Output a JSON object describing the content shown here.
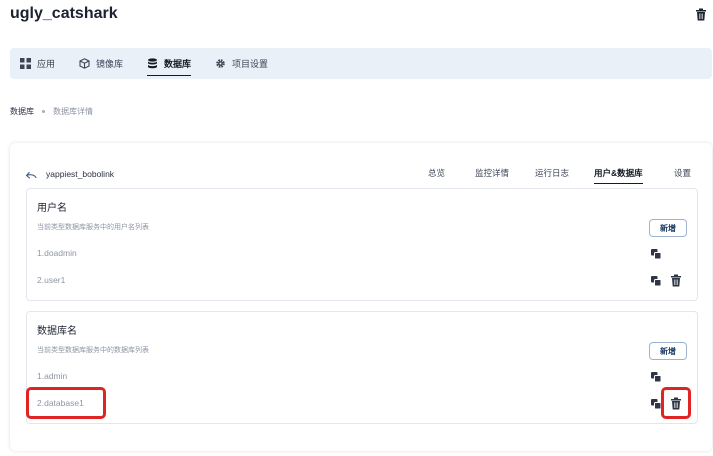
{
  "app": {
    "title": "ugly_catshark"
  },
  "nav": {
    "items": [
      {
        "label": "应用",
        "icon": "grid-icon",
        "active": false
      },
      {
        "label": "镜像库",
        "icon": "cube-icon",
        "active": false
      },
      {
        "label": "数据库",
        "icon": "database-icon",
        "active": true
      },
      {
        "label": "项目设置",
        "icon": "gear-icon",
        "active": false
      }
    ]
  },
  "breadcrumb": {
    "root": "数据库",
    "current": "数据库详情"
  },
  "instance": {
    "name": "yappiest_bobolink"
  },
  "tabs": [
    {
      "label": "总览",
      "active": false
    },
    {
      "label": "监控详情",
      "active": false
    },
    {
      "label": "运行日志",
      "active": false
    },
    {
      "label": "用户&数据库",
      "active": true
    },
    {
      "label": "设置",
      "active": false
    }
  ],
  "users": {
    "title": "用户名",
    "description": "当前类型数据库服务中的用户名列表",
    "add_label": "新增",
    "rows": [
      {
        "name": "1.doadmin",
        "deletable": false
      },
      {
        "name": "2.user1",
        "deletable": true
      }
    ]
  },
  "databases": {
    "title": "数据库名",
    "description": "当前类型数据库服务中的数据库列表",
    "add_label": "新增",
    "rows": [
      {
        "name": "1.admin",
        "deletable": false
      },
      {
        "name": "2.database1",
        "deletable": true
      }
    ]
  },
  "colors": {
    "accent": "#151b26",
    "nav_bg": "#eaf0f8",
    "highlight": "#e02424",
    "muted_text": "#8e96a3"
  }
}
